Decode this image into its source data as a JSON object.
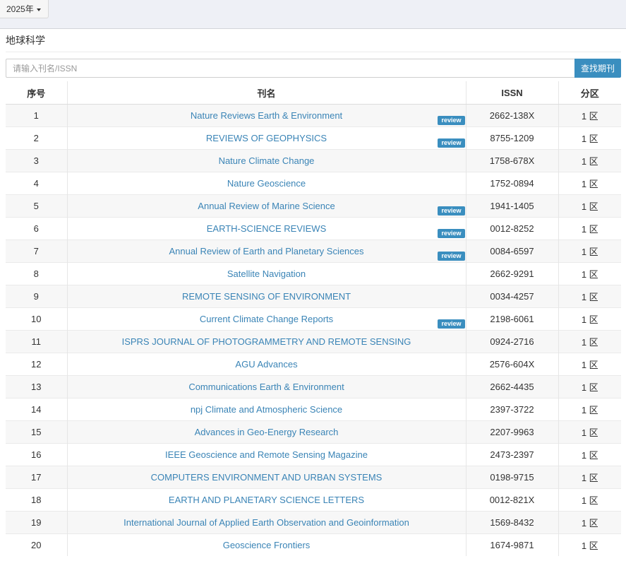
{
  "year_selector": {
    "label": "2025年"
  },
  "category": {
    "title": "地球科学"
  },
  "search": {
    "placeholder": "请输入刊名/ISSN",
    "button_label": "查找期刊"
  },
  "table": {
    "headers": {
      "index": "序号",
      "name": "刊名",
      "issn": "ISSN",
      "zone": "分区"
    },
    "badge_label": "review",
    "rows": [
      {
        "index": "1",
        "name": "Nature Reviews Earth & Environment",
        "issn": "2662-138X",
        "zone": "1 区",
        "review": true
      },
      {
        "index": "2",
        "name": "REVIEWS OF GEOPHYSICS",
        "issn": "8755-1209",
        "zone": "1 区",
        "review": true
      },
      {
        "index": "3",
        "name": "Nature Climate Change",
        "issn": "1758-678X",
        "zone": "1 区",
        "review": false
      },
      {
        "index": "4",
        "name": "Nature Geoscience",
        "issn": "1752-0894",
        "zone": "1 区",
        "review": false
      },
      {
        "index": "5",
        "name": "Annual Review of Marine Science",
        "issn": "1941-1405",
        "zone": "1 区",
        "review": true
      },
      {
        "index": "6",
        "name": "EARTH-SCIENCE REVIEWS",
        "issn": "0012-8252",
        "zone": "1 区",
        "review": true
      },
      {
        "index": "7",
        "name": "Annual Review of Earth and Planetary Sciences",
        "issn": "0084-6597",
        "zone": "1 区",
        "review": true
      },
      {
        "index": "8",
        "name": "Satellite Navigation",
        "issn": "2662-9291",
        "zone": "1 区",
        "review": false
      },
      {
        "index": "9",
        "name": "REMOTE SENSING OF ENVIRONMENT",
        "issn": "0034-4257",
        "zone": "1 区",
        "review": false
      },
      {
        "index": "10",
        "name": "Current Climate Change Reports",
        "issn": "2198-6061",
        "zone": "1 区",
        "review": true
      },
      {
        "index": "11",
        "name": "ISPRS JOURNAL OF PHOTOGRAMMETRY AND REMOTE SENSING",
        "issn": "0924-2716",
        "zone": "1 区",
        "review": false
      },
      {
        "index": "12",
        "name": "AGU Advances",
        "issn": "2576-604X",
        "zone": "1 区",
        "review": false
      },
      {
        "index": "13",
        "name": "Communications Earth & Environment",
        "issn": "2662-4435",
        "zone": "1 区",
        "review": false
      },
      {
        "index": "14",
        "name": "npj Climate and Atmospheric Science",
        "issn": "2397-3722",
        "zone": "1 区",
        "review": false
      },
      {
        "index": "15",
        "name": "Advances in Geo-Energy Research",
        "issn": "2207-9963",
        "zone": "1 区",
        "review": false
      },
      {
        "index": "16",
        "name": "IEEE Geoscience and Remote Sensing Magazine",
        "issn": "2473-2397",
        "zone": "1 区",
        "review": false
      },
      {
        "index": "17",
        "name": "COMPUTERS ENVIRONMENT AND URBAN SYSTEMS",
        "issn": "0198-9715",
        "zone": "1 区",
        "review": false
      },
      {
        "index": "18",
        "name": "EARTH AND PLANETARY SCIENCE LETTERS",
        "issn": "0012-821X",
        "zone": "1 区",
        "review": false
      },
      {
        "index": "19",
        "name": "International Journal of Applied Earth Observation and Geoinformation",
        "issn": "1569-8432",
        "zone": "1 区",
        "review": false
      },
      {
        "index": "20",
        "name": "Geoscience Frontiers",
        "issn": "1674-9871",
        "zone": "1 区",
        "review": false
      }
    ]
  },
  "colors": {
    "accent": "#3a8ebf",
    "link": "#3a84b6",
    "topbar": "#eef0f6"
  }
}
